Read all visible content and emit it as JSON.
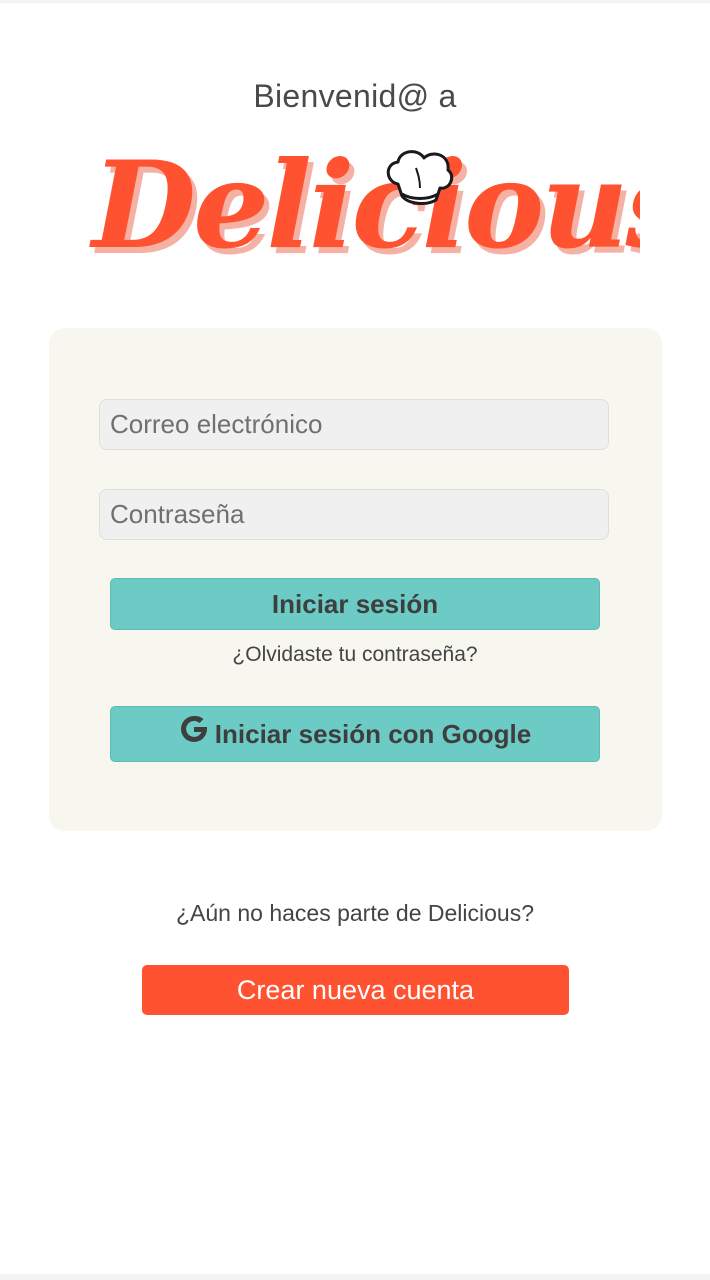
{
  "header": {
    "welcome_text": "Bienvenid@ a",
    "logo_text": "Delicious !"
  },
  "login_form": {
    "email_placeholder": "Correo electrónico",
    "password_placeholder": "Contraseña",
    "login_button_label": "Iniciar sesión",
    "forgot_password_link": "¿Olvidaste tu contraseña?",
    "google_button_label": "Iniciar sesión con Google",
    "google_icon": "google-icon"
  },
  "signup": {
    "prompt": "¿Aún no haces parte de Delicious?",
    "create_account_label": "Crear nueva cuenta"
  },
  "colors": {
    "brand_red": "#ff5230",
    "logo_shadow": "#f6b1a5",
    "teal": "#6ccbc4",
    "card_background": "#f7f7f0"
  }
}
